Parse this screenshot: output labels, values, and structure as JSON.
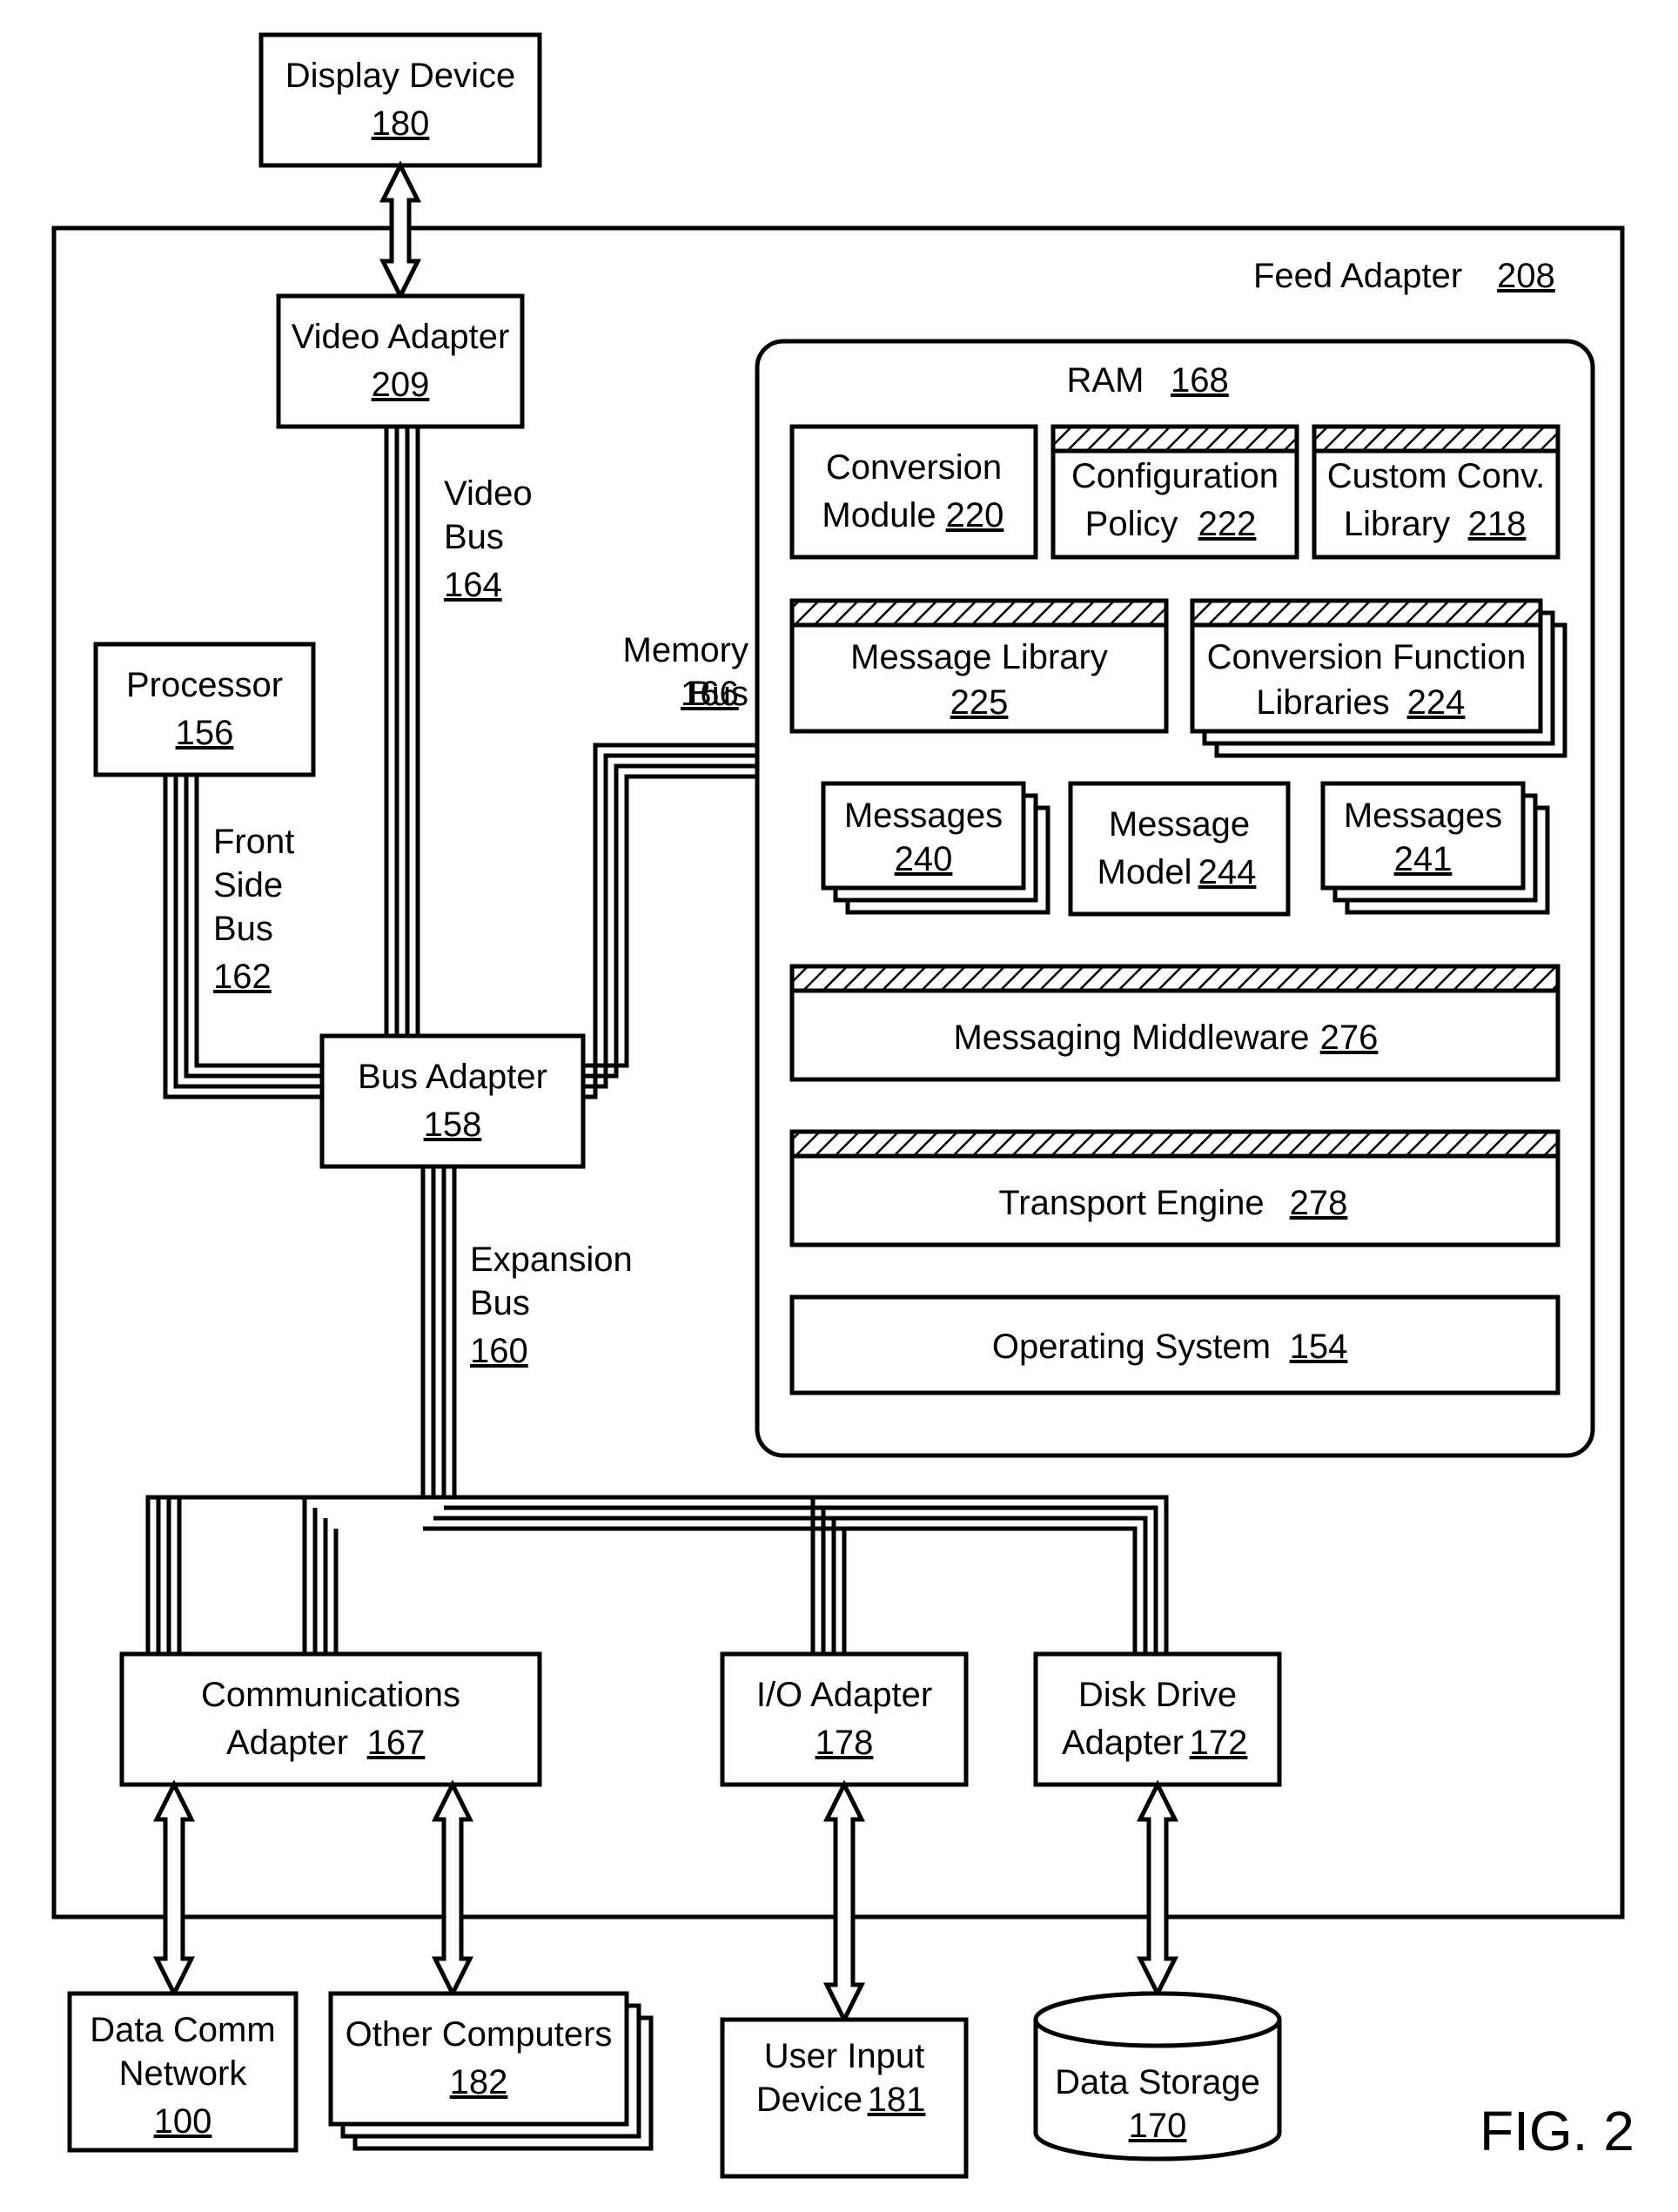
{
  "fig_caption": "FIG. 2",
  "feed_adapter": {
    "label": "Feed Adapter",
    "ref": "208"
  },
  "display_device": {
    "label": "Display Device",
    "ref": "180"
  },
  "video_adapter": {
    "label": "Video Adapter",
    "ref": "209"
  },
  "video_bus": {
    "label1": "Video",
    "label2": "Bus",
    "ref": "164"
  },
  "processor": {
    "label": "Processor",
    "ref": "156"
  },
  "front_side_bus": {
    "l1": "Front",
    "l2": "Side",
    "l3": "Bus",
    "ref": "162"
  },
  "memory_bus": {
    "l1": "Memory",
    "l2": "Bus",
    "ref": "166"
  },
  "bus_adapter": {
    "label": "Bus Adapter",
    "ref": "158"
  },
  "expansion_bus": {
    "l1": "Expansion",
    "l2": "Bus",
    "ref": "160"
  },
  "ram": {
    "label": "RAM",
    "ref": "168"
  },
  "conversion_module": {
    "l1": "Conversion",
    "l2": "Module",
    "ref": "220"
  },
  "configuration_policy": {
    "l1": "Configuration",
    "l2": "Policy",
    "ref": "222"
  },
  "custom_conv": {
    "l1": "Custom Conv.",
    "l2": "Library",
    "ref": "218"
  },
  "message_library": {
    "l1": "Message Library",
    "ref": "225"
  },
  "conversion_function_libs": {
    "l1": "Conversion Function",
    "l2": "Libraries",
    "ref": "224"
  },
  "messages_240": {
    "l1": "Messages",
    "ref": "240"
  },
  "message_model": {
    "l1": "Message",
    "l2": "Model",
    "ref": "244"
  },
  "messages_241": {
    "l1": "Messages",
    "ref": "241"
  },
  "messaging_middleware": {
    "l1": "Messaging Middleware",
    "ref": "276"
  },
  "transport_engine": {
    "l1": "Transport Engine",
    "ref": "278"
  },
  "operating_system": {
    "l1": "Operating System",
    "ref": "154"
  },
  "communications_adapter": {
    "l1": "Communications",
    "l2": "Adapter",
    "ref": "167"
  },
  "io_adapter": {
    "l1": "I/O Adapter",
    "ref": "178"
  },
  "disk_drive_adapter": {
    "l1": "Disk Drive",
    "l2": "Adapter",
    "ref": "172"
  },
  "data_comm_network": {
    "l1": "Data Comm",
    "l2": "Network",
    "ref": "100"
  },
  "other_computers": {
    "l1": "Other Computers",
    "ref": "182"
  },
  "user_input_device": {
    "l1": "User Input",
    "l2": "Device",
    "ref": "181"
  },
  "data_storage": {
    "l1": "Data Storage",
    "ref": "170"
  }
}
